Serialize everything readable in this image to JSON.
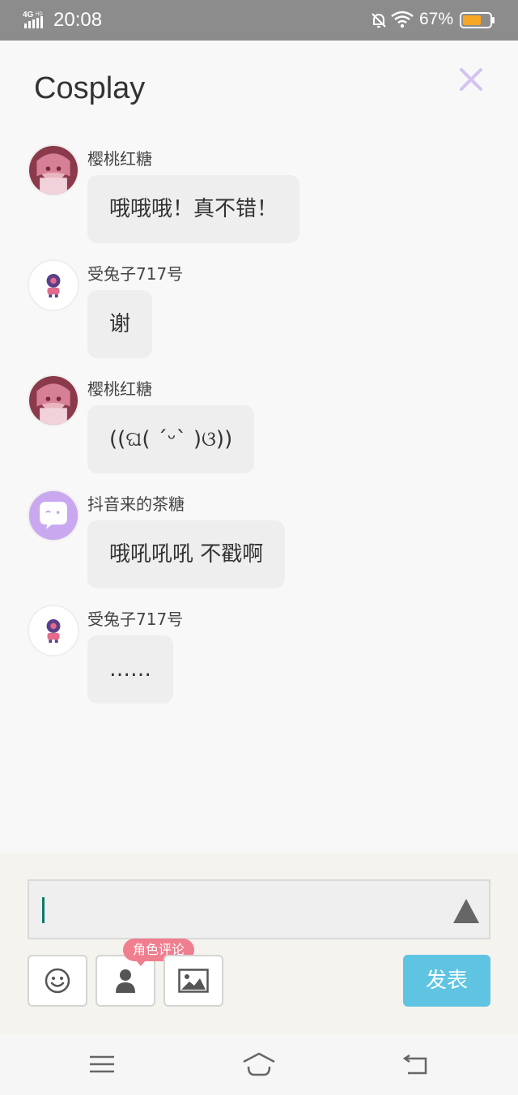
{
  "status_bar": {
    "network": "4G HD",
    "time": "20:08",
    "battery_percent": "67%",
    "battery_color": "#f5a623"
  },
  "header": {
    "title": "Cosplay",
    "close_icon": "close-icon"
  },
  "messages": [
    {
      "username": "樱桃红糖",
      "text": "哦哦哦！真不错！",
      "avatar": "pink-anime-avatar"
    },
    {
      "username": "受兔子717号",
      "text": "谢",
      "avatar": "purple-creature-avatar"
    },
    {
      "username": "樱桃红糖",
      "text": "((ଘ( ˊᵕˋ )ଓ))",
      "avatar": "pink-anime-avatar"
    },
    {
      "username": "抖音来的茶糖",
      "text": "哦吼吼吼 不戳啊",
      "avatar": "purple-chat-bubble-avatar"
    },
    {
      "username": "受兔子717号",
      "text": "……",
      "avatar": "purple-creature-avatar"
    }
  ],
  "composer": {
    "input_value": "",
    "role_tooltip": "角色评论",
    "send_label": "发表",
    "tools": [
      "emoji-icon",
      "person-icon",
      "image-icon"
    ]
  },
  "nav_bar": {
    "buttons": [
      "menu-icon",
      "home-icon",
      "back-icon"
    ]
  },
  "colors": {
    "accent": "#5ec4e2",
    "tooltip": "#ef7e8e",
    "close": "#d4c2f0"
  }
}
